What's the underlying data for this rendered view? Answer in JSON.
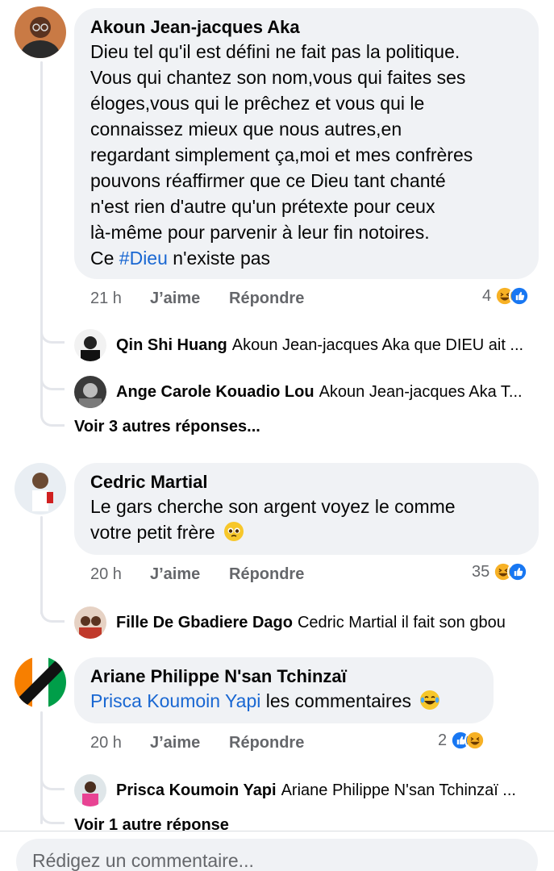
{
  "comments": [
    {
      "author": "Akoun Jean-jacques Aka",
      "text_lines": [
        "Dieu tel qu'il est défini ne fait pas la politique.",
        "Vous qui chantez son nom,vous qui faites ses",
        "éloges,vous qui le prêchez et vous qui le",
        "connaissez mieux que nous autres,en",
        "regardant simplement ça,moi et mes confrères",
        "pouvons réaffirmer que ce Dieu tant chanté",
        "n'est rien d'autre qu'un prétexte pour ceux",
        "là-même pour parvenir à leur fin notoires."
      ],
      "last_line_prefix": "Ce ",
      "hashtag": "#Dieu",
      "last_line_suffix": " n'existe pas",
      "time": "21 h",
      "like_label": "J’aime",
      "reply_label": "Répondre",
      "reaction_count": "4",
      "reactions": [
        "haha",
        "like"
      ],
      "replies": [
        {
          "name": "Qin Shi Huang",
          "text": "Akoun Jean-jacques Aka que DIEU ait ..."
        },
        {
          "name": "Ange Carole Kouadio Lou",
          "text": "Akoun Jean-jacques Aka T..."
        }
      ],
      "more_replies": "Voir 3 autres réponses..."
    },
    {
      "author": "Cedric Martial",
      "text_lines": [
        "Le gars cherche son argent voyez le comme",
        "votre petit frère"
      ],
      "emoji": "pleading-face",
      "time": "20 h",
      "like_label": "J’aime",
      "reply_label": "Répondre",
      "reaction_count": "35",
      "reactions": [
        "haha",
        "like"
      ],
      "replies": [
        {
          "name": "Fille De Gbadiere Dago",
          "text": "Cedric Martial il fait son gbou"
        }
      ]
    },
    {
      "author": "Ariane Philippe N'san Tchinzaï",
      "mention": "Prisca Koumoin Yapi",
      "text_after_mention": " les commentaires",
      "emoji": "joy-face",
      "time": "20 h",
      "like_label": "J’aime",
      "reply_label": "Répondre",
      "reaction_count": "2",
      "reactions": [
        "like",
        "haha"
      ],
      "replies": [
        {
          "name": "Prisca Koumoin Yapi",
          "text": "Ariane Philippe N'san Tchinzaï ..."
        }
      ],
      "more_replies": "Voir 1 autre réponse"
    }
  ],
  "composer": {
    "placeholder": "Rédigez un commentaire..."
  },
  "colors": {
    "bubble": "#f0f2f5",
    "link": "#1967d2",
    "meta": "#65676b",
    "like_blue": "#1877f2",
    "haha_yellow": "#f7b125"
  }
}
